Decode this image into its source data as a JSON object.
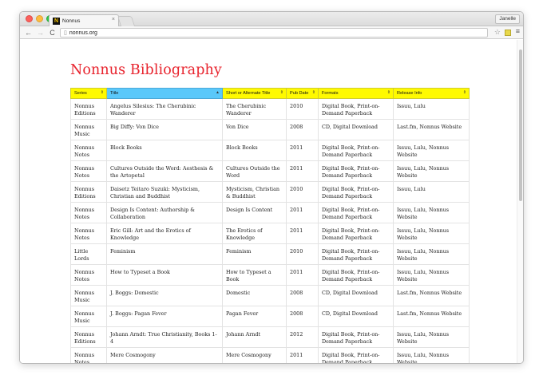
{
  "browser": {
    "tab_title": "Nonnus",
    "tab_close": "×",
    "favicon_letter": "N",
    "profile_name": "Janelle",
    "url": "nonnus.org",
    "nav": {
      "back": "←",
      "forward": "→",
      "reload": "C",
      "home": "⌂"
    },
    "star": "☆",
    "menu": "≡"
  },
  "page": {
    "title": "Nonnus Bibliography",
    "colors": {
      "title": "#e8232d",
      "header_bg": "#fffa00",
      "sorted_header_bg": "#5ac8fa"
    },
    "table": {
      "columns": [
        {
          "label": "Series",
          "arrow": "⇕",
          "sorted": false
        },
        {
          "label": "Title",
          "arrow": "▲",
          "sorted": true
        },
        {
          "label": "Short or Alternate Title",
          "arrow": "⇕",
          "sorted": false
        },
        {
          "label": "Pub Date",
          "arrow": "⇕",
          "sorted": false
        },
        {
          "label": "Formats",
          "arrow": "⇕",
          "sorted": false
        },
        {
          "label": "Release Info",
          "arrow": "⇕",
          "sorted": false
        }
      ],
      "rows": [
        [
          "Nonnus Editions",
          "Angelus Silesius: The Cherubinic Wanderer",
          "The Cherubinic Wanderer",
          "2010",
          "Digital Book, Print-on-Demand Paperback",
          "Issuu, Lulu"
        ],
        [
          "Nonnus Music",
          "Big Diffy: Von Dice",
          "Von Dice",
          "2008",
          "CD, Digital Download",
          "Last.fm, Nonnus Website"
        ],
        [
          "Nonnus Notes",
          "Block Books",
          "Block Books",
          "2011",
          "Digital Book, Print-on-Demand Paperback",
          "Issuu, Lulu, Nonnus Website"
        ],
        [
          "Nonnus Notes",
          "Cultures Outside the Word: Aesthesis & the Artopetal",
          "Cultures Outside the Word",
          "2011",
          "Digital Book, Print-on-Demand Paperback",
          "Issuu, Lulu, Nonnus Website"
        ],
        [
          "Nonnus Editions",
          "Daisetz Teitaro Suzuki: Mysticism, Christian and Buddhist",
          "Mysticism, Christian & Buddhist",
          "2010",
          "Digital Book, Print-on-Demand Paperback",
          "Issuu, Lulu"
        ],
        [
          "Nonnus Notes",
          "Design Is Content: Authorship & Collaboration",
          "Design Is Content",
          "2011",
          "Digital Book, Print-on-Demand Paperback",
          "Issuu, Lulu, Nonnus Website"
        ],
        [
          "Nonnus Notes",
          "Eric Gill: Art and the Erotics of Knowledge",
          "The Erotics of Knowledge",
          "2011",
          "Digital Book, Print-on-Demand Paperback",
          "Issuu, Lulu, Nonnus Website"
        ],
        [
          "Little Lords",
          "Feminism",
          "Feminism",
          "2010",
          "Digital Book, Print-on-Demand Paperback",
          "Issuu, Lulu, Nonnus Website"
        ],
        [
          "Nonnus Notes",
          "How to Typeset a Book",
          "How to Typeset a Book",
          "2011",
          "Digital Book, Print-on-Demand Paperback",
          "Issuu, Lulu, Nonnus Website"
        ],
        [
          "Nonnus Music",
          "J. Boggs: Domestic",
          "Domestic",
          "2008",
          "CD, Digital Download",
          "Last.fm, Nonnus Website"
        ],
        [
          "Nonnus Music",
          "J. Boggs: Pagan Fever",
          "Pagan Fever",
          "2008",
          "CD, Digital Download",
          "Last.fm, Nonnus Website"
        ],
        [
          "Nonnus Editions",
          "Johann Arndt: True Christianity, Books 1-4",
          "Johann Arndt",
          "2012",
          "Digital Book, Print-on-Demand Paperback",
          "Issuu, Lulu, Nonnus Website"
        ],
        [
          "Nonnus Notes",
          "Mere Cosmogony",
          "Mere Cosmogony",
          "2011",
          "Digital Book, Print-on-Demand Paperback",
          "Issuu, Lulu, Nonnus Website"
        ]
      ]
    }
  }
}
